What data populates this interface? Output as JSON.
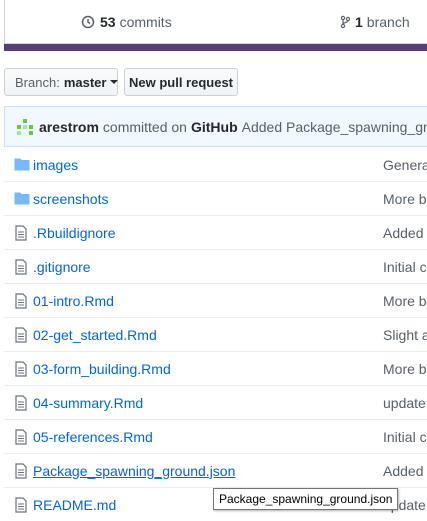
{
  "summary": {
    "commits_count": "53",
    "commits_label": "commits",
    "branch_count": "1",
    "branch_label": "branch"
  },
  "toolbar": {
    "branch_label": "Branch:",
    "branch_value": "master",
    "new_pr_label": "New pull request"
  },
  "commit": {
    "author": "arestrom",
    "action": "committed on",
    "platform": "GitHub",
    "message": "Added Package_spawning_ground.json"
  },
  "files": [
    {
      "type": "folder",
      "name": "images",
      "message": "Genera"
    },
    {
      "type": "folder",
      "name": "screenshots",
      "message": "More b"
    },
    {
      "type": "file",
      "name": ".Rbuildignore",
      "message": "Added"
    },
    {
      "type": "file",
      "name": ".gitignore",
      "message": "Initial c"
    },
    {
      "type": "file",
      "name": "01-intro.Rmd",
      "message": "More b"
    },
    {
      "type": "file",
      "name": "02-get_started.Rmd",
      "message": "Slight a"
    },
    {
      "type": "file",
      "name": "03-form_building.Rmd",
      "message": "More b"
    },
    {
      "type": "file",
      "name": "04-summary.Rmd",
      "message": "update"
    },
    {
      "type": "file",
      "name": "05-references.Rmd",
      "message": "Initial c"
    },
    {
      "type": "file",
      "name": "Package_spawning_ground.json",
      "message": "Added"
    },
    {
      "type": "file",
      "name": "README.md",
      "message": "update"
    }
  ],
  "tooltip": "Package_spawning_ground.json",
  "colors": {
    "link": "#0366d6",
    "langbar": "#563d7c",
    "commitbar": "#f1f8ff"
  }
}
